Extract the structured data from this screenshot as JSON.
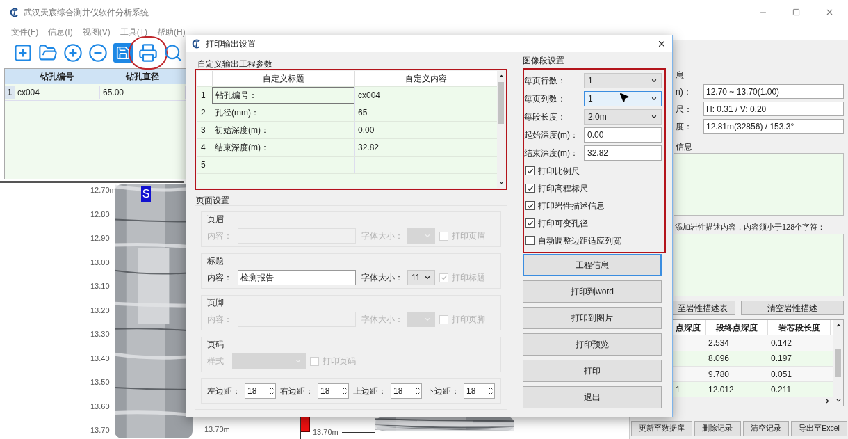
{
  "window": {
    "title": "武汉天宸综合测井仪软件分析系统"
  },
  "menu": [
    {
      "label": "文件(F)"
    },
    {
      "label": "信息(I)"
    },
    {
      "label": "视图(V)"
    },
    {
      "label": "工具(T)"
    },
    {
      "label": "帮助(H)"
    }
  ],
  "toolbar": [
    {
      "kind": "new",
      "circled": false
    },
    {
      "kind": "open",
      "circled": false
    },
    {
      "kind": "zoom_in",
      "circled": false
    },
    {
      "kind": "zoom_out",
      "circled": false
    },
    {
      "kind": "save",
      "circled": false
    },
    {
      "kind": "print",
      "circled": true
    },
    {
      "kind": "search",
      "circled": false
    }
  ],
  "borehole_table": {
    "columns": [
      "钻孔编号",
      "钻孔直径"
    ],
    "rows": [
      {
        "number": "1",
        "cells": [
          "cx004",
          "65.00"
        ]
      }
    ]
  },
  "core_view": {
    "depth_labels": [
      "12.70m",
      "12.80",
      "12.90",
      "13.00",
      "13.10",
      "13.20",
      "13.30",
      "13.40",
      "13.50",
      "13.60",
      "13.70"
    ],
    "marker": "S",
    "bottom_labels": [
      "13.70m",
      "13.70m"
    ]
  },
  "dialog": {
    "title": "打印输出设置",
    "params": {
      "title": "自定义输出工程参数",
      "columns": [
        "自定义标题",
        "自定义内容"
      ],
      "rows": [
        {
          "number": "1",
          "title": "钻孔编号：",
          "content": "cx004",
          "selected": true
        },
        {
          "number": "2",
          "title": "孔径(mm)：",
          "content": "65",
          "selected": false
        },
        {
          "number": "3",
          "title": "初始深度(m)：",
          "content": "0.00",
          "selected": false
        },
        {
          "number": "4",
          "title": "结束深度(m)：",
          "content": "32.82",
          "selected": false
        },
        {
          "number": "5",
          "selected": false
        }
      ]
    },
    "page_setup": {
      "title": "页面设置",
      "sections": [
        {
          "kind": "text",
          "title": "页眉",
          "content_label": "内容：",
          "size_label": "字体大小：",
          "check_label": "打印页眉",
          "disabled": true,
          "checked": false
        },
        {
          "kind": "text",
          "title": "标题",
          "content_label": "内容：",
          "value": "检测报告",
          "size_label": "字体大小：",
          "size": "11",
          "check_label": "打印标题",
          "disabled": false,
          "checked": true
        },
        {
          "kind": "text",
          "title": "页脚",
          "content_label": "内容：",
          "size_label": "字体大小：",
          "check_label": "打印页脚",
          "disabled": true,
          "checked": false
        },
        {
          "kind": "page_number",
          "title": "页码",
          "style_label": "样式",
          "check_label": "打印页码",
          "disabled": true,
          "checked": false
        }
      ],
      "margins": [
        {
          "label": "左边距：",
          "value": "18"
        },
        {
          "label": "右边距：",
          "value": "18"
        },
        {
          "label": "上边距：",
          "value": "18"
        },
        {
          "label": "下边距：",
          "value": "18"
        }
      ]
    },
    "image_setup": {
      "title": "图像段设置",
      "fields": [
        {
          "kind": "combo",
          "label": "每页行数：",
          "value": "1",
          "focused": false
        },
        {
          "kind": "combo",
          "label": "每页列数：",
          "value": "1",
          "focused": true
        },
        {
          "kind": "combo",
          "label": "每段长度：",
          "value": "2.0m",
          "focused": false
        },
        {
          "kind": "input",
          "label": "起始深度(m)：",
          "value": "0.00",
          "focused": false
        },
        {
          "kind": "input",
          "label": "结束深度(m)：",
          "value": "32.82",
          "focused": false
        }
      ],
      "options": [
        {
          "label": "打印比例尺",
          "checked": true
        },
        {
          "label": "打印高程标尺",
          "checked": true
        },
        {
          "label": "打印岩性描述信息",
          "checked": true
        },
        {
          "label": "打印可变孔径",
          "checked": true
        },
        {
          "label": "自动调整边距适应列宽",
          "checked": false
        }
      ],
      "buttons": [
        {
          "label": "工程信息",
          "focused": true
        },
        {
          "label": "打印到word",
          "focused": false
        },
        {
          "label": "打印到图片",
          "focused": false
        },
        {
          "label": "打印预览",
          "focused": false
        },
        {
          "label": "打印",
          "focused": false
        },
        {
          "label": "退出",
          "focused": false
        }
      ]
    }
  },
  "right_panel": {
    "section_title": "息",
    "fields": [
      {
        "label": "n)：",
        "value": "12.70 ~ 13.70(1.00)"
      },
      {
        "label": "尺：",
        "value": "H: 0.31 / V: 0.20"
      },
      {
        "label": "度：",
        "value": "12.81m(32856) / 153.3°"
      }
    ],
    "description_title": "信息",
    "hint": "添加岩性描述内容，内容须小于128个字符：",
    "buttons": [
      "至岩性描述表",
      "清空岩性描述"
    ],
    "table": {
      "columns": [
        "点深度",
        "段终点深度",
        "岩芯段长度"
      ],
      "rows": [
        {
          "end": "2.534",
          "length": "0.142"
        },
        {
          "end": "8.096",
          "length": "0.197"
        },
        {
          "end": "9.780",
          "length": "0.051"
        },
        {
          "start": "1",
          "end": "12.012",
          "length": "0.211"
        }
      ]
    },
    "actions": [
      "更新至数据库",
      "删除记录",
      "清空记录",
      "导出至Excel"
    ]
  }
}
